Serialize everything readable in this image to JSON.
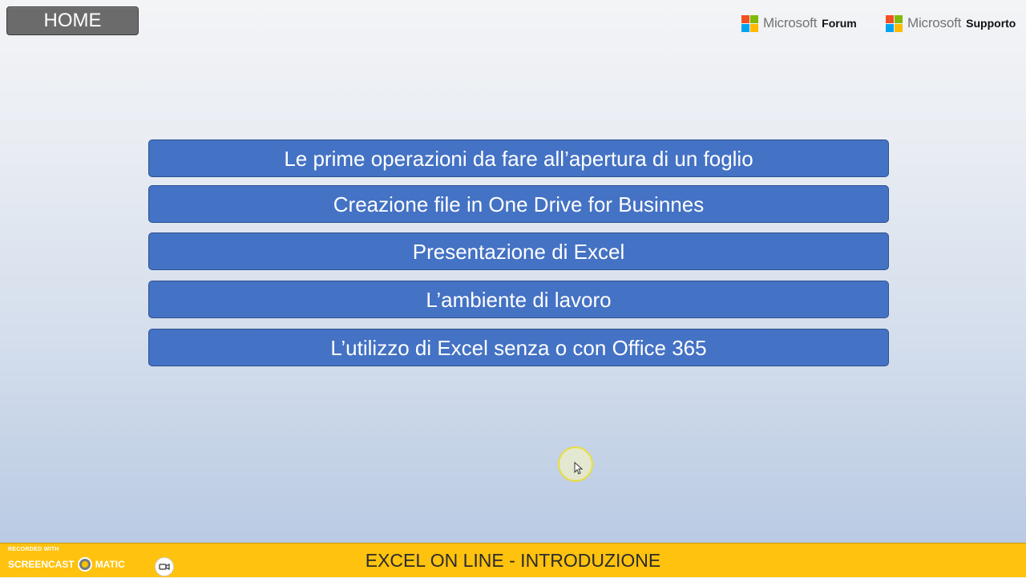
{
  "header": {
    "home_label": "HOME",
    "links": [
      {
        "brand": "Microsoft",
        "label": "Forum"
      },
      {
        "brand": "Microsoft",
        "label": "Supporto"
      }
    ]
  },
  "menu": {
    "items": [
      "Le prime operazioni da fare all’apertura di un foglio",
      "Creazione file in One Drive for Businnes",
      "Presentazione di Excel",
      "L’ambiente di lavoro",
      "L’utilizzo di Excel senza o con Office 365"
    ]
  },
  "footer": {
    "title": "EXCEL ON LINE - INTRODUZIONE",
    "recorder_small": "RECORDED WITH",
    "recorder_left": "SCREENCAST",
    "recorder_right": "MATIC"
  },
  "colors": {
    "menu_button": "#4472c4",
    "home_button": "#6b6b6b",
    "footer_bar": "#ffc20e",
    "ms_red": "#f25022",
    "ms_green": "#7fba00",
    "ms_blue": "#00a4ef",
    "ms_yellow": "#ffb900"
  },
  "icons": {
    "logo": "microsoft-logo-icon",
    "pointer": "mouse-pointer-icon",
    "camera": "video-camera-icon"
  }
}
